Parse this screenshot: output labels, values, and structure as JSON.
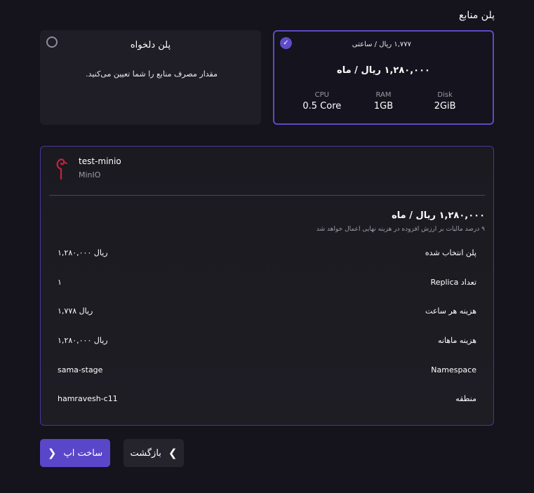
{
  "section_title": "پلن منابع",
  "plans": {
    "fixed": {
      "hourly_price": "۱,۷۷۷ ریال / ساعتی",
      "monthly_price": "۱,۲۸۰,۰۰۰ ریال / ماه",
      "specs": [
        {
          "label": "Disk",
          "value": "2GiB"
        },
        {
          "label": "RAM",
          "value": "1GB"
        },
        {
          "label": "CPU",
          "value": "0.5 Core"
        }
      ],
      "selected": true,
      "check_icon": "check-icon"
    },
    "custom": {
      "title": "پلن دلخواه",
      "description": "مقدار مصرف منابع را شما تعیین می‌کنید.",
      "selected": false
    }
  },
  "summary": {
    "app_name": "test-minio",
    "app_type": "MinIO",
    "app_icon": "minio-flamingo-icon",
    "total": "۱,۲۸۰,۰۰۰ ریال / ماه",
    "vat_note": "۹ درصد مالیات بر ارزش افزوده در هزینه نهایی اعمال خواهد شد",
    "rows": [
      {
        "label": "پلن انتخاب شده",
        "value": "۱,۲۸۰,۰۰۰ ریال"
      },
      {
        "label": "تعداد Replica",
        "value": "۱"
      },
      {
        "label": "هزینه هر ساعت",
        "value": "۱,۷۷۸ ریال"
      },
      {
        "label": "هزینه ماهانه",
        "value": "۱,۲۸۰,۰۰۰ ریال"
      },
      {
        "label": "Namespace",
        "value": "sama-stage"
      },
      {
        "label": "منطقه",
        "value": "hamravesh-c11"
      }
    ]
  },
  "buttons": {
    "create_label": "ساخت اپ",
    "back_label": "بازگشت"
  },
  "colors": {
    "accent": "#5a46c9",
    "background": "#15131b",
    "card": "#1f1e26"
  }
}
